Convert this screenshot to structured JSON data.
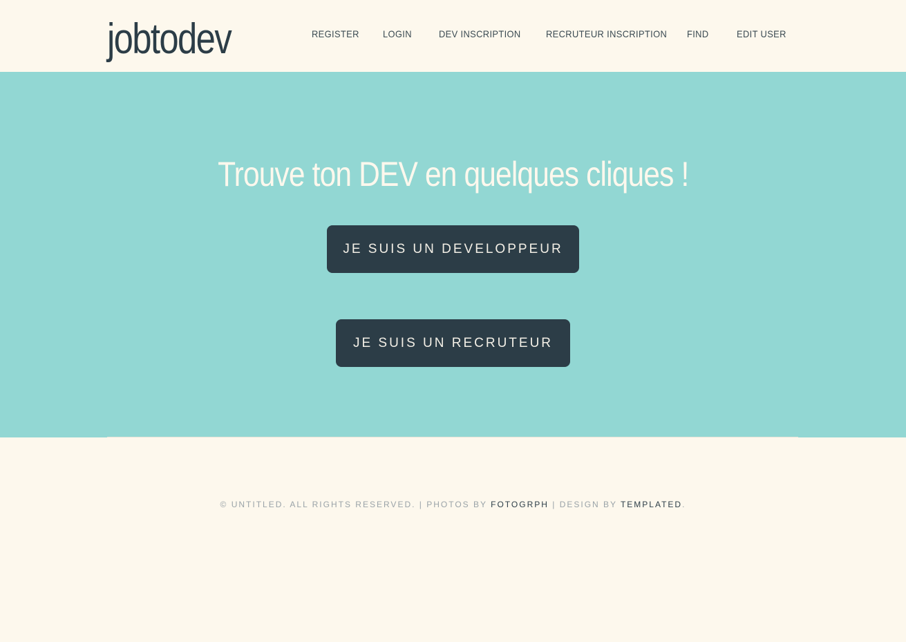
{
  "header": {
    "logo": "jobtodev",
    "nav": [
      {
        "label": "REGISTER"
      },
      {
        "label": "LOGIN"
      },
      {
        "label": "DEV INSCRIPTION"
      },
      {
        "label": "RECRUTEUR INSCRIPTION"
      },
      {
        "label": "FIND"
      },
      {
        "label": "EDIT USER"
      }
    ]
  },
  "hero": {
    "title": "Trouve ton DEV en quelques cliques !",
    "developer_button": "JE SUIS UN DEVELOPPEUR",
    "recruiter_button": "JE SUIS UN RECRUTEUR"
  },
  "footer": {
    "copyright": "© UNTITLED. ALL RIGHTS RESERVED. | PHOTOS BY ",
    "photos_link": "FOTOGRPH",
    "design_text": " | DESIGN BY ",
    "design_link": "TEMPLATED",
    "end": "."
  },
  "colors": {
    "background": "#fdf8ed",
    "hero": "#92d7d3",
    "button": "#2c3d47",
    "text_dark": "#2c3d47"
  }
}
